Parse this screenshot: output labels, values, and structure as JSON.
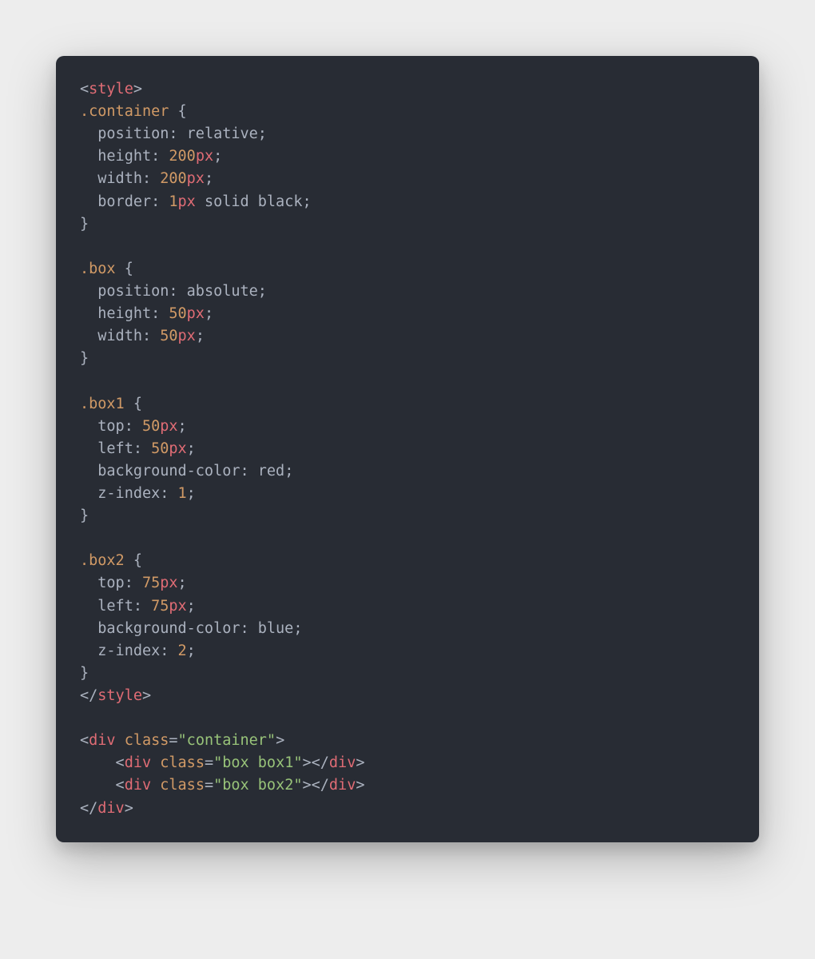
{
  "code": {
    "lines": [
      [
        {
          "cls": "t-punct",
          "text": "<"
        },
        {
          "cls": "t-tag",
          "text": "style"
        },
        {
          "cls": "t-punct",
          "text": ">"
        }
      ],
      [
        {
          "cls": "t-selector",
          "text": ".container"
        },
        {
          "cls": "t-punct",
          "text": " "
        },
        {
          "cls": "t-brace",
          "text": "{"
        }
      ],
      [
        {
          "cls": "t-prop",
          "text": "  position"
        },
        {
          "cls": "t-punct",
          "text": ": "
        },
        {
          "cls": "t-value",
          "text": "relative"
        },
        {
          "cls": "t-punct",
          "text": ";"
        }
      ],
      [
        {
          "cls": "t-prop",
          "text": "  height"
        },
        {
          "cls": "t-punct",
          "text": ": "
        },
        {
          "cls": "t-num",
          "text": "200"
        },
        {
          "cls": "t-unit",
          "text": "px"
        },
        {
          "cls": "t-punct",
          "text": ";"
        }
      ],
      [
        {
          "cls": "t-prop",
          "text": "  width"
        },
        {
          "cls": "t-punct",
          "text": ": "
        },
        {
          "cls": "t-num",
          "text": "200"
        },
        {
          "cls": "t-unit",
          "text": "px"
        },
        {
          "cls": "t-punct",
          "text": ";"
        }
      ],
      [
        {
          "cls": "t-prop",
          "text": "  border"
        },
        {
          "cls": "t-punct",
          "text": ": "
        },
        {
          "cls": "t-num",
          "text": "1"
        },
        {
          "cls": "t-unit",
          "text": "px"
        },
        {
          "cls": "t-value",
          "text": " solid black"
        },
        {
          "cls": "t-punct",
          "text": ";"
        }
      ],
      [
        {
          "cls": "t-brace",
          "text": "}"
        }
      ],
      [
        {
          "cls": "",
          "text": ""
        }
      ],
      [
        {
          "cls": "t-selector",
          "text": ".box"
        },
        {
          "cls": "t-punct",
          "text": " "
        },
        {
          "cls": "t-brace",
          "text": "{"
        }
      ],
      [
        {
          "cls": "t-prop",
          "text": "  position"
        },
        {
          "cls": "t-punct",
          "text": ": "
        },
        {
          "cls": "t-value",
          "text": "absolute"
        },
        {
          "cls": "t-punct",
          "text": ";"
        }
      ],
      [
        {
          "cls": "t-prop",
          "text": "  height"
        },
        {
          "cls": "t-punct",
          "text": ": "
        },
        {
          "cls": "t-num",
          "text": "50"
        },
        {
          "cls": "t-unit",
          "text": "px"
        },
        {
          "cls": "t-punct",
          "text": ";"
        }
      ],
      [
        {
          "cls": "t-prop",
          "text": "  width"
        },
        {
          "cls": "t-punct",
          "text": ": "
        },
        {
          "cls": "t-num",
          "text": "50"
        },
        {
          "cls": "t-unit",
          "text": "px"
        },
        {
          "cls": "t-punct",
          "text": ";"
        }
      ],
      [
        {
          "cls": "t-brace",
          "text": "}"
        }
      ],
      [
        {
          "cls": "",
          "text": ""
        }
      ],
      [
        {
          "cls": "t-selector",
          "text": ".box1"
        },
        {
          "cls": "t-punct",
          "text": " "
        },
        {
          "cls": "t-brace",
          "text": "{"
        }
      ],
      [
        {
          "cls": "t-prop",
          "text": "  top"
        },
        {
          "cls": "t-punct",
          "text": ": "
        },
        {
          "cls": "t-num",
          "text": "50"
        },
        {
          "cls": "t-unit",
          "text": "px"
        },
        {
          "cls": "t-punct",
          "text": ";"
        }
      ],
      [
        {
          "cls": "t-prop",
          "text": "  left"
        },
        {
          "cls": "t-punct",
          "text": ": "
        },
        {
          "cls": "t-num",
          "text": "50"
        },
        {
          "cls": "t-unit",
          "text": "px"
        },
        {
          "cls": "t-punct",
          "text": ";"
        }
      ],
      [
        {
          "cls": "t-prop",
          "text": "  background-color"
        },
        {
          "cls": "t-punct",
          "text": ": "
        },
        {
          "cls": "t-color",
          "text": "red"
        },
        {
          "cls": "t-punct",
          "text": ";"
        }
      ],
      [
        {
          "cls": "t-prop",
          "text": "  z-index"
        },
        {
          "cls": "t-punct",
          "text": ": "
        },
        {
          "cls": "t-num",
          "text": "1"
        },
        {
          "cls": "t-punct",
          "text": ";"
        }
      ],
      [
        {
          "cls": "t-brace",
          "text": "}"
        }
      ],
      [
        {
          "cls": "",
          "text": ""
        }
      ],
      [
        {
          "cls": "t-selector",
          "text": ".box2"
        },
        {
          "cls": "t-punct",
          "text": " "
        },
        {
          "cls": "t-brace",
          "text": "{"
        }
      ],
      [
        {
          "cls": "t-prop",
          "text": "  top"
        },
        {
          "cls": "t-punct",
          "text": ": "
        },
        {
          "cls": "t-num",
          "text": "75"
        },
        {
          "cls": "t-unit",
          "text": "px"
        },
        {
          "cls": "t-punct",
          "text": ";"
        }
      ],
      [
        {
          "cls": "t-prop",
          "text": "  left"
        },
        {
          "cls": "t-punct",
          "text": ": "
        },
        {
          "cls": "t-num",
          "text": "75"
        },
        {
          "cls": "t-unit",
          "text": "px"
        },
        {
          "cls": "t-punct",
          "text": ";"
        }
      ],
      [
        {
          "cls": "t-prop",
          "text": "  background-color"
        },
        {
          "cls": "t-punct",
          "text": ": "
        },
        {
          "cls": "t-color",
          "text": "blue"
        },
        {
          "cls": "t-punct",
          "text": ";"
        }
      ],
      [
        {
          "cls": "t-prop",
          "text": "  z-index"
        },
        {
          "cls": "t-punct",
          "text": ": "
        },
        {
          "cls": "t-num",
          "text": "2"
        },
        {
          "cls": "t-punct",
          "text": ";"
        }
      ],
      [
        {
          "cls": "t-brace",
          "text": "}"
        }
      ],
      [
        {
          "cls": "t-punct",
          "text": "</"
        },
        {
          "cls": "t-tag",
          "text": "style"
        },
        {
          "cls": "t-punct",
          "text": ">"
        }
      ],
      [
        {
          "cls": "",
          "text": ""
        }
      ],
      [
        {
          "cls": "t-punct",
          "text": "<"
        },
        {
          "cls": "t-tag",
          "text": "div"
        },
        {
          "cls": "t-punct",
          "text": " "
        },
        {
          "cls": "t-attr",
          "text": "class"
        },
        {
          "cls": "t-punct",
          "text": "="
        },
        {
          "cls": "t-str",
          "text": "\"container\""
        },
        {
          "cls": "t-punct",
          "text": ">"
        }
      ],
      [
        {
          "cls": "t-punct",
          "text": "    <"
        },
        {
          "cls": "t-tag",
          "text": "div"
        },
        {
          "cls": "t-punct",
          "text": " "
        },
        {
          "cls": "t-attr",
          "text": "class"
        },
        {
          "cls": "t-punct",
          "text": "="
        },
        {
          "cls": "t-str",
          "text": "\"box box1\""
        },
        {
          "cls": "t-punct",
          "text": "></"
        },
        {
          "cls": "t-tag",
          "text": "div"
        },
        {
          "cls": "t-punct",
          "text": ">"
        }
      ],
      [
        {
          "cls": "t-punct",
          "text": "    <"
        },
        {
          "cls": "t-tag",
          "text": "div"
        },
        {
          "cls": "t-punct",
          "text": " "
        },
        {
          "cls": "t-attr",
          "text": "class"
        },
        {
          "cls": "t-punct",
          "text": "="
        },
        {
          "cls": "t-str",
          "text": "\"box box2\""
        },
        {
          "cls": "t-punct",
          "text": "></"
        },
        {
          "cls": "t-tag",
          "text": "div"
        },
        {
          "cls": "t-punct",
          "text": ">"
        }
      ],
      [
        {
          "cls": "t-punct",
          "text": "</"
        },
        {
          "cls": "t-tag",
          "text": "div"
        },
        {
          "cls": "t-punct",
          "text": ">"
        }
      ]
    ]
  }
}
